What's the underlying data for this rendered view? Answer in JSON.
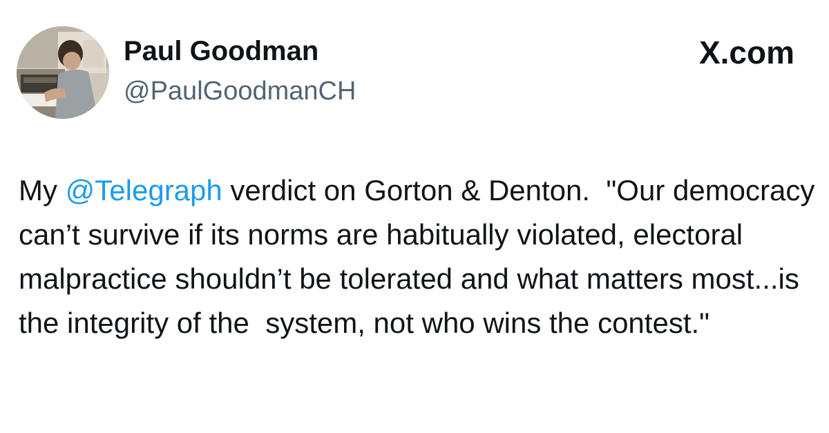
{
  "author": {
    "display_name": "Paul Goodman",
    "handle": "@PaulGoodmanCH"
  },
  "brand": {
    "logo_text": "X.com"
  },
  "tweet": {
    "text_before_mention": "My ",
    "mention": "@Telegraph",
    "text_after_mention": " verdict on Gorton & Denton.  \"Our democracy can’t survive if its norms are habitually violated, electoral malpractice shouldn’t be tolerated and what matters most...is the integrity of the  system, not who wins the contest.\""
  },
  "colors": {
    "mention": "#1d9bf0",
    "handle": "#536471",
    "text": "#0f1419",
    "background": "#ffffff"
  },
  "icons": {
    "avatar": "profile-photo-avatar"
  }
}
